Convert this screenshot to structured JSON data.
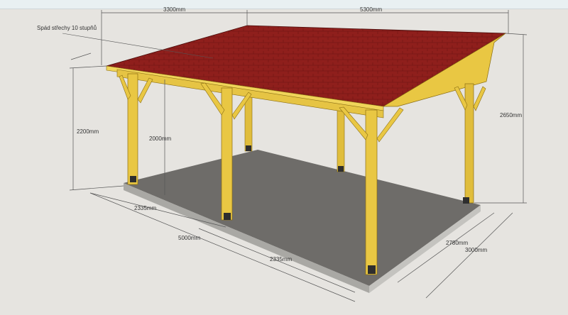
{
  "colors": {
    "background": "#e6e4e0",
    "wood": "#e9c743",
    "wood_shade": "#c9a52a",
    "roof": "#8f1f1c",
    "slab": "#6e6c69",
    "slab_edge": "#b3b2ae",
    "dimension_line": "#555555"
  },
  "annotations": {
    "roof_slope": "Spád střechy 10 stupňů"
  },
  "dimensions": {
    "top_left_width": "3300mm",
    "top_right_width": "5300mm",
    "left_height": "2200mm",
    "inner_height": "2000mm",
    "right_height": "2650mm",
    "bottom_left_bay": "2335mm",
    "bottom_total_length": "5000mm",
    "bottom_right_bay": "2335mm",
    "right_depth_inner": "2780mm",
    "right_depth_total": "3000mm"
  }
}
